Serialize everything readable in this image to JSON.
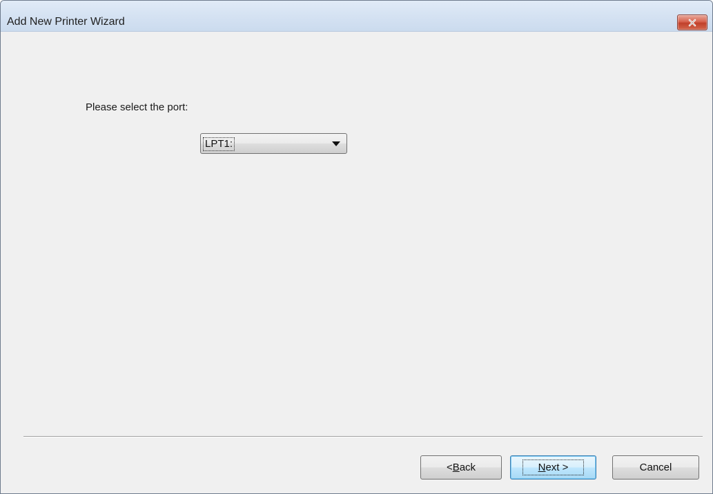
{
  "window": {
    "title": "Add New Printer Wizard",
    "close_icon": "close-icon"
  },
  "main": {
    "prompt": "Please select the port:",
    "port": {
      "selected": "LPT1:"
    }
  },
  "footer": {
    "back": {
      "prefix": "< ",
      "accel": "B",
      "rest": "ack"
    },
    "next": {
      "accel": "N",
      "rest": "ext >"
    },
    "cancel": "Cancel"
  },
  "colors": {
    "title_bar": "#d6e3f3",
    "close_button": "#c94a36",
    "dialog_bg": "#f0f0f0",
    "default_button": "#bee6fd"
  }
}
